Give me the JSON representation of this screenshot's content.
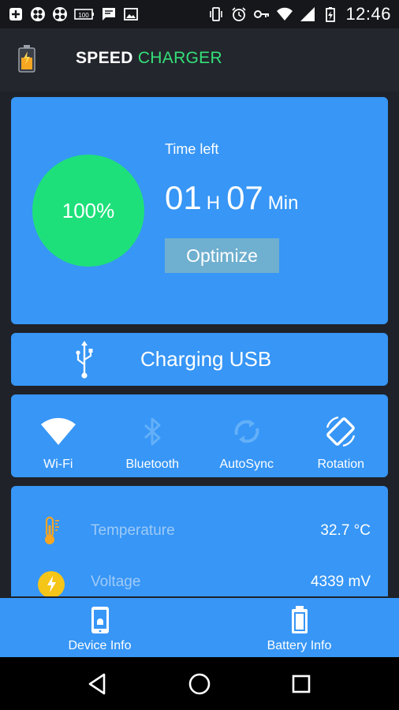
{
  "status_bar": {
    "time": "12:46",
    "battery_badge": "100",
    "left_icons": [
      "plus-box-icon",
      "clover-icon",
      "fan-icon",
      "battery-100-icon",
      "message-icon",
      "image-icon"
    ],
    "right_icons": [
      "vibrate-icon",
      "alarm-icon",
      "key-icon",
      "wifi-icon",
      "signal-icon",
      "battery-charging-icon"
    ]
  },
  "app_bar": {
    "title_part1": "SPEED",
    "title_part2": "CHARGER"
  },
  "battery_card": {
    "percent": "100%",
    "time_left_label": "Time left",
    "hours": "01",
    "hours_unit": "H",
    "minutes": "07",
    "minutes_unit": "Min",
    "optimize_label": "Optimize"
  },
  "charging_card": {
    "label": "Charging USB"
  },
  "toggles": [
    {
      "label": "Wi-Fi",
      "icon": "wifi-icon",
      "active": true
    },
    {
      "label": "Bluetooth",
      "icon": "bluetooth-icon",
      "active": false
    },
    {
      "label": "AutoSync",
      "icon": "sync-icon",
      "active": false
    },
    {
      "label": "Rotation",
      "icon": "rotation-icon",
      "active": true
    }
  ],
  "info_rows": [
    {
      "name": "Temperature",
      "value": "32.7 °C",
      "icon": "thermometer-icon"
    },
    {
      "name": "Voltage",
      "value": "4339 mV",
      "icon": "lightning-icon"
    }
  ],
  "bottom_nav": [
    {
      "label": "Device Info",
      "icon": "phone-android-icon"
    },
    {
      "label": "Battery Info",
      "icon": "battery-icon"
    }
  ],
  "colors": {
    "background": "#1f2228",
    "card": "#3796f6",
    "accent_green": "#1ee07a",
    "title_green": "#34e07a",
    "optimize_button": "#6fafcf"
  }
}
